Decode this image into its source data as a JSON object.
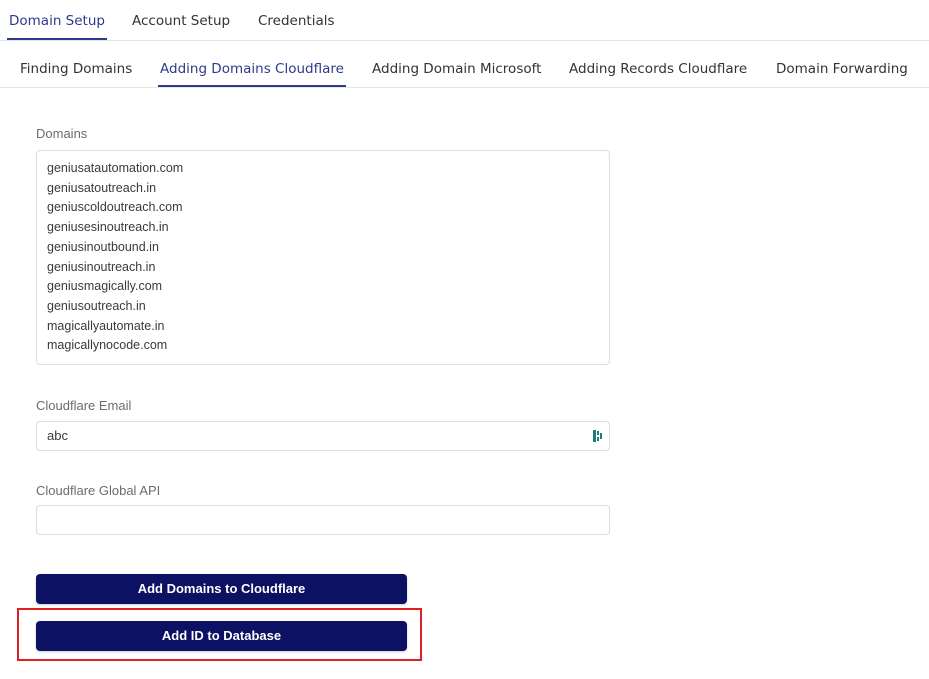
{
  "top_tabs": [
    {
      "label": "Domain Setup",
      "active": true
    },
    {
      "label": "Account Setup",
      "active": false
    },
    {
      "label": "Credentials",
      "active": false
    }
  ],
  "sub_tabs": [
    {
      "label": "Finding Domains",
      "active": false
    },
    {
      "label": "Adding Domains Cloudflare",
      "active": true
    },
    {
      "label": "Adding Domain Microsoft",
      "active": false
    },
    {
      "label": "Adding Records Cloudflare",
      "active": false
    },
    {
      "label": "Domain Forwarding",
      "active": false
    }
  ],
  "form": {
    "domains_label": "Domains",
    "domains": [
      "geniusatautomation.com",
      "geniusatoutreach.in",
      "geniuscoldoutreach.com",
      "geniusesinoutreach.in",
      "geniusinoutbound.in",
      "geniusinoutreach.in",
      "geniusmagically.com",
      "geniusoutreach.in",
      "magicallyautomate.in",
      "magicallynocode.com"
    ],
    "email_label": "Cloudflare Email",
    "email_value": "abc",
    "api_label": "Cloudflare Global API",
    "api_value": ""
  },
  "buttons": {
    "add_domains": "Add Domains to Cloudflare",
    "add_id": "Add ID to Database"
  },
  "colors": {
    "accent": "#2d3a8c",
    "button_bg": "#0c1163",
    "highlight": "#e02020"
  }
}
